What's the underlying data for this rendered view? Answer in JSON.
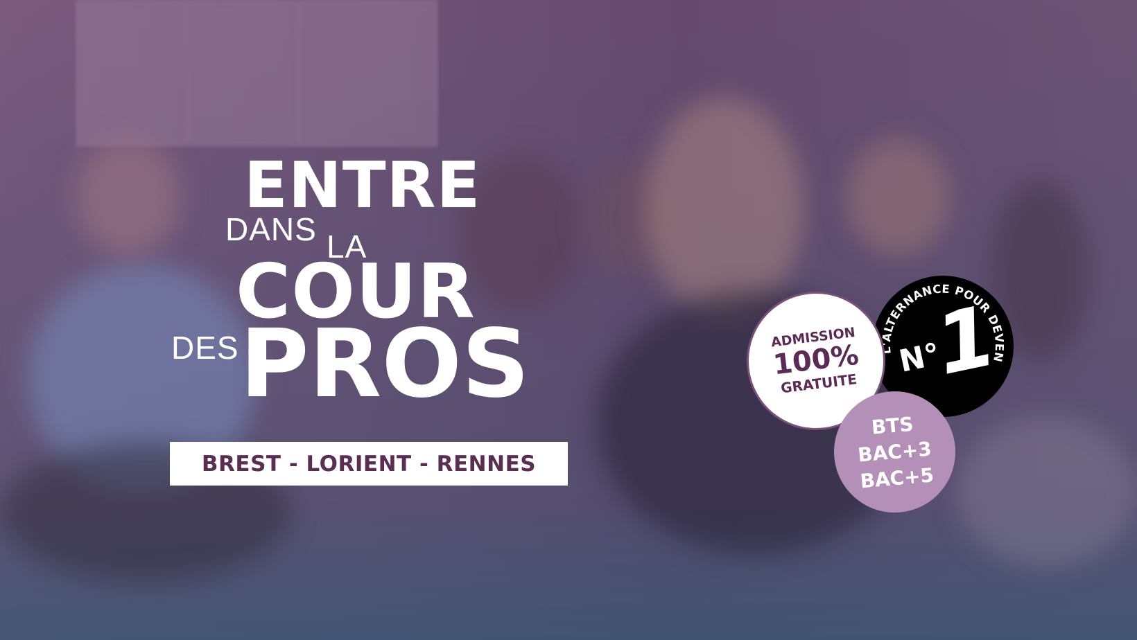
{
  "headline": {
    "line1": "ENTRE",
    "line2a": "DANS",
    "line2b": "LA",
    "line3": "COUR",
    "line4a": "DES",
    "line4b": "PROS"
  },
  "cities": "BREST - LORIENT - RENNES",
  "badges": {
    "admission": {
      "line1": "ADMISSION",
      "line2": "100%",
      "line3": "GRATUITE"
    },
    "no1": {
      "curve_text": "L'ALTERNANCE POUR DEVENIR",
      "prefix": "N°",
      "number": "1"
    },
    "levels": [
      "BTS",
      "BAC+3",
      "BAC+5"
    ]
  },
  "colors": {
    "brand_plum": "#5a2d52",
    "overlay_purple": "#6e5276",
    "badge_lilac": "#b48fb8",
    "badge_black": "#000000",
    "white": "#ffffff"
  }
}
